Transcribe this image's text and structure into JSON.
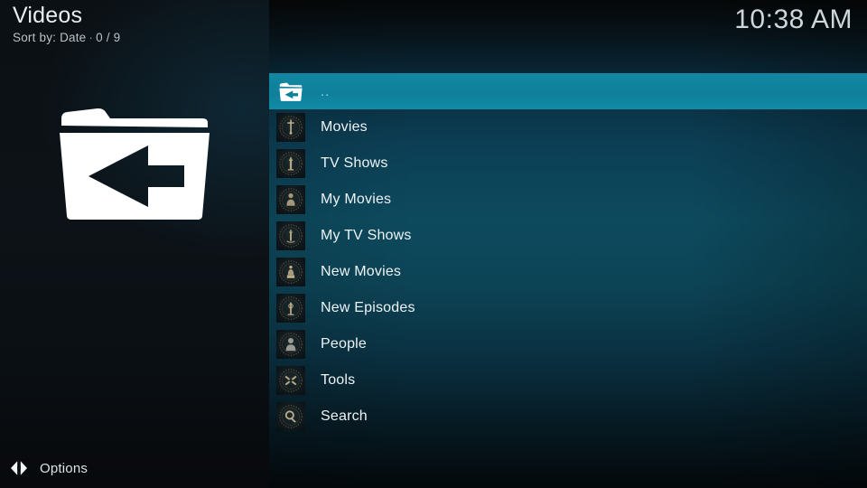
{
  "window": {
    "app": "Kodi",
    "screen_title": "Videos"
  },
  "header": {
    "title": "Videos",
    "sort_label": "Sort by: Date",
    "separator": "·",
    "counter": "0 / 9"
  },
  "clock": {
    "time": "10:38 AM"
  },
  "info_panel": {
    "thumbnail_icon": "folder-up-icon",
    "thumbnail_alt": "Parent folder"
  },
  "footer": {
    "options_icon": "options-arrows-icon",
    "options_label": "Options"
  },
  "file_list": {
    "selected_index": 0,
    "items": [
      {
        "label": "..",
        "icon": "folder-up-icon",
        "selected": true,
        "emblem": "none"
      },
      {
        "label": "Movies",
        "icon": "artwork-icon",
        "selected": false,
        "emblem": "film-reel"
      },
      {
        "label": "TV Shows",
        "icon": "artwork-icon",
        "selected": false,
        "emblem": "tv-set"
      },
      {
        "label": "My Movies",
        "icon": "artwork-icon",
        "selected": false,
        "emblem": "film-strip"
      },
      {
        "label": "My TV Shows",
        "icon": "artwork-icon",
        "selected": false,
        "emblem": "tv-antenna"
      },
      {
        "label": "New Movies",
        "icon": "artwork-icon",
        "selected": false,
        "emblem": "new-badge"
      },
      {
        "label": "New Episodes",
        "icon": "artwork-icon",
        "selected": false,
        "emblem": "episode"
      },
      {
        "label": "People",
        "icon": "artwork-icon",
        "selected": false,
        "emblem": "person"
      },
      {
        "label": "Tools",
        "icon": "artwork-icon",
        "selected": false,
        "emblem": "tools-cross"
      },
      {
        "label": "Search",
        "icon": "artwork-icon",
        "selected": false,
        "emblem": "magnifier"
      }
    ]
  },
  "colors": {
    "highlight": "#0f7f9b",
    "panel_teal": "#0d4a5e",
    "left_panel_bg": "#0b1014",
    "text_primary": "#eef3f5",
    "text_secondary": "#b9c2c7"
  }
}
